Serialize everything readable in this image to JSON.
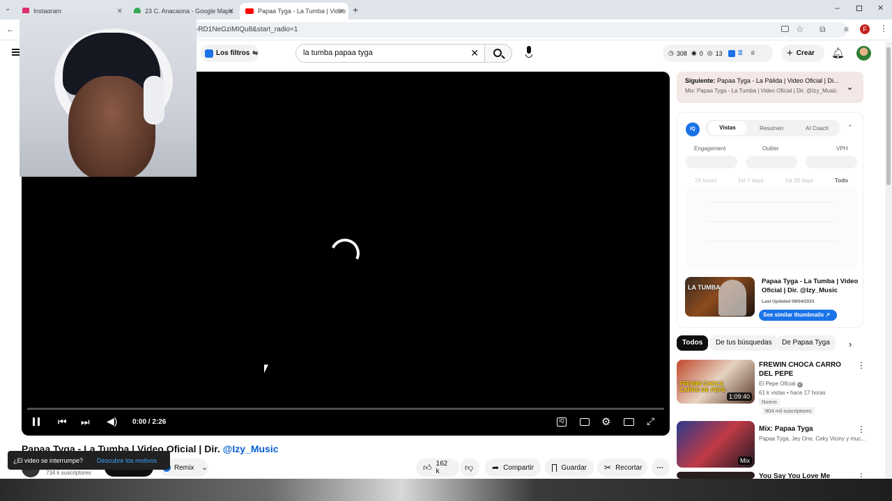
{
  "browser": {
    "tabs": [
      {
        "title": "Instagram",
        "color": "#e1306c"
      },
      {
        "title": "23 C. Anacaona - Google Maps",
        "color": "#34a853"
      },
      {
        "title": "Papaa Tyga - La Tumba | Video",
        "color": "#ff0000"
      }
    ],
    "url_fragment": "-RD1NeGziMIQu8&start_radio=1",
    "profile_initial": "F"
  },
  "header": {
    "filters_label": "Los filtros",
    "search_value": "la tumba papaa tyga",
    "stats": {
      "views": "308",
      "a": "0",
      "b": "13"
    },
    "create_label": "Crear"
  },
  "player": {
    "time": "0:00 / 2:26",
    "progress": 0.0
  },
  "video_info": {
    "title": "Papaa Tyga - La Tumba | Video Oficial | Dir. ",
    "title_link": "@Izy_Music",
    "subscribers": "734 k suscriptores",
    "remix_label": "Remix",
    "likes": "162 k",
    "share_label": "Compartir",
    "save_label": "Guardar",
    "clip_label": "Recortar"
  },
  "toast": {
    "text": "¿El video se interrumpe?",
    "link": "Descubre los motivos"
  },
  "up_next": {
    "label": "Siguiente: ",
    "title": "Papaa Tyga - La Pálida | Video Oficial | Di...",
    "subtitle": "Mix: Papaa Tyga - La Tumba | Video Oficial | Dir. @Izy_Music"
  },
  "iq_panel": {
    "tabs": [
      "Vistas",
      "Resumen",
      "AI Coach"
    ],
    "metrics": [
      "Engagement",
      "Outlier",
      "VPH"
    ],
    "ranges": [
      "24 hours",
      "1st 7 days",
      "1st 28 days",
      "Todo"
    ],
    "card_title": "Papaa Tyga - La Tumba | Video Oficial | Dir. @Izy_Music",
    "card_updated": "Last Updated 08/04/2023",
    "card_button": "See similar thumbnails",
    "thumb_text": "LA TUMBA"
  },
  "chips": [
    "Todos",
    "De tus búsquedas",
    "De Papaa Tyga"
  ],
  "related": [
    {
      "title": "FREWIN CHOCA CARRO DEL PEPE",
      "channel": "El Pepe Oficial",
      "meta": "61 k vistas • hace 17 horas",
      "badge": "Nuevo",
      "extra": "904 mil suscriptores",
      "duration": "1:09:40",
      "thumb_text": "FREWIN CHOCA CARRO DE PEPE"
    },
    {
      "title": "Mix: Papaa Tyga",
      "channel": "Papaa Tyga, Jey One, Ceky Viciny y muc...",
      "duration": "Mix"
    },
    {
      "title": "You Say You Love Me"
    }
  ]
}
